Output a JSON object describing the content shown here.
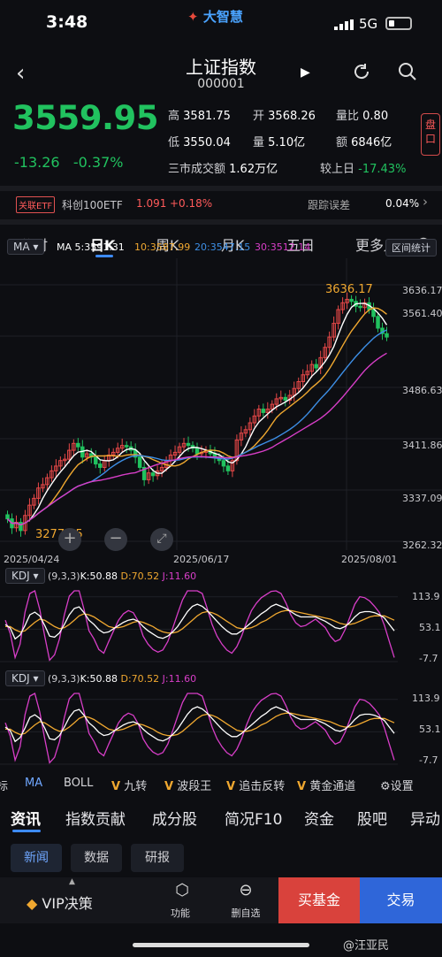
{
  "status": {
    "time": "3:48",
    "brand": "大智慧",
    "network": "5G"
  },
  "header": {
    "title": "上证指数",
    "code": "000001"
  },
  "quote": {
    "price": "3559.95",
    "change": "-13.26",
    "pct": "-0.37%",
    "high_label": "高",
    "high": "3581.75",
    "open_label": "开",
    "open": "3568.26",
    "vr_label": "量比",
    "vr": "0.80",
    "low_label": "低",
    "low": "3550.04",
    "vol_label": "量",
    "vol": "5.10亿",
    "amt_label": "额",
    "amt": "6846亿",
    "market_turnover_label": "三市成交额",
    "market_turnover": "1.62万亿",
    "vs_prev_label": "较上日",
    "vs_prev": "-17.43%",
    "panel_btn": "盘口"
  },
  "etf": {
    "tag": "关联ETF",
    "name": "科创100ETF",
    "price": "1.091",
    "pct": "+0.18%",
    "track_label": "跟踪误差",
    "track": "0.04%"
  },
  "tabs": [
    "分时",
    "日K",
    "周K",
    "月K",
    "五日",
    "更多"
  ],
  "ma": {
    "chip": "MA",
    "ma5": "MA 5:3591.31",
    "ma10": "10:3587.99",
    "ma20": "20:3547.15",
    "ma30": "30:3512.14",
    "range_btn": "区间统计",
    "colors": {
      "ma5": "#ffffff",
      "ma10": "#f0a830",
      "ma20": "#3d8fe6",
      "ma30": "#d83ec8"
    }
  },
  "kline": {
    "y_ticks": [
      "3636.17",
      "3561.40",
      "3486.63",
      "3411.86",
      "3337.09",
      "3262.32"
    ],
    "dates": [
      "2025/04/24",
      "2025/06/17",
      "2025/08/01"
    ],
    "max_label": "3636.17",
    "min_label": "3277.55"
  },
  "kdj1": {
    "name": "KDJ",
    "params": "(9,3,3)",
    "k": "K:50.88",
    "d": "D:70.52",
    "j": "J:11.60",
    "y_ticks": [
      "113.9",
      "53.1",
      "-7.7"
    ]
  },
  "kdj2": {
    "name": "KDJ",
    "params": "(9,3,3)",
    "k": "K:50.88",
    "d": "D:70.52",
    "j": "J:11.60",
    "y_ticks": [
      "113.9",
      "53.1",
      "-7.7"
    ]
  },
  "indicators": [
    "标",
    "MA",
    "BOLL",
    "九转",
    "波段王",
    "追击反转",
    "黄金通道",
    "设置"
  ],
  "info_tabs": [
    "资讯",
    "指数贡献",
    "成分股",
    "简况F10",
    "资金",
    "股吧",
    "异动"
  ],
  "sub_tabs": [
    "新闻",
    "数据",
    "研报"
  ],
  "bottom": {
    "vip": "VIP决策",
    "func": "功能",
    "delete": "删自选",
    "buy": "买基金",
    "trade": "交易"
  },
  "watermark": "@汪亚民",
  "chart_data": {
    "type": "candlestick",
    "title": "",
    "y_range": [
      3262.32,
      3636.17
    ],
    "x_labels": [
      "2025/04/24",
      "2025/06/17",
      "2025/08/01"
    ],
    "ma": {
      "MA5": 3591.31,
      "MA10": 3587.99,
      "MA20": 3547.15,
      "MA30": 3512.14
    },
    "high_marker": 3636.17,
    "low_marker": 3277.55,
    "closes": [
      3295,
      3282,
      3290,
      3278,
      3300,
      3315,
      3325,
      3340,
      3345,
      3355,
      3365,
      3372,
      3380,
      3382,
      3395,
      3405,
      3400,
      3385,
      3390,
      3385,
      3375,
      3370,
      3380,
      3388,
      3392,
      3398,
      3402,
      3400,
      3395,
      3385,
      3370,
      3352,
      3362,
      3358,
      3365,
      3370,
      3380,
      3388,
      3392,
      3400,
      3405,
      3402,
      3398,
      3390,
      3392,
      3395,
      3390,
      3385,
      3380,
      3372,
      3365,
      3380,
      3410,
      3420,
      3425,
      3435,
      3445,
      3455,
      3450,
      3455,
      3462,
      3470,
      3472,
      3468,
      3475,
      3485,
      3495,
      3505,
      3510,
      3520,
      3515,
      3530,
      3545,
      3560,
      3580,
      3600,
      3610,
      3615,
      3612,
      3605,
      3603,
      3610,
      3600,
      3590,
      3573,
      3565,
      3560
    ]
  },
  "kdj_data": {
    "k": [
      62,
      55,
      35,
      42,
      60,
      80,
      85,
      78,
      60,
      40,
      38,
      46,
      62,
      80,
      92,
      95,
      84,
      70,
      62,
      52,
      46,
      48,
      54,
      60,
      66,
      70,
      72,
      68,
      58,
      50,
      44,
      38,
      36,
      40,
      48,
      58,
      72,
      86,
      96,
      100,
      96,
      88,
      78,
      68,
      58,
      50,
      44,
      44,
      50,
      58,
      66,
      74,
      82,
      88,
      96,
      100,
      96,
      92,
      86,
      80,
      76,
      76,
      76,
      76,
      72,
      68,
      62,
      56,
      54,
      58,
      66,
      76,
      84,
      86,
      86,
      84,
      80,
      74,
      62,
      50
    ],
    "d": [
      58,
      58,
      52,
      48,
      50,
      58,
      66,
      72,
      70,
      64,
      58,
      54,
      56,
      62,
      70,
      78,
      82,
      80,
      76,
      70,
      64,
      58,
      56,
      56,
      58,
      62,
      66,
      68,
      66,
      62,
      58,
      52,
      48,
      46,
      46,
      48,
      54,
      62,
      70,
      78,
      84,
      86,
      84,
      80,
      74,
      68,
      62,
      56,
      54,
      54,
      56,
      60,
      66,
      70,
      76,
      82,
      86,
      88,
      88,
      86,
      84,
      82,
      80,
      78,
      76,
      74,
      72,
      68,
      64,
      62,
      62,
      64,
      68,
      72,
      76,
      78,
      78,
      78,
      74,
      70
    ],
    "j": [
      70,
      45,
      0,
      25,
      85,
      120,
      125,
      90,
      40,
      -5,
      5,
      35,
      80,
      115,
      125,
      125,
      90,
      50,
      35,
      15,
      8,
      30,
      50,
      70,
      82,
      88,
      84,
      68,
      40,
      25,
      15,
      10,
      14,
      30,
      55,
      82,
      108,
      125,
      125,
      125,
      120,
      92,
      62,
      40,
      25,
      14,
      8,
      20,
      40,
      66,
      88,
      102,
      112,
      118,
      124,
      125,
      120,
      102,
      80,
      65,
      58,
      60,
      66,
      72,
      64,
      56,
      40,
      30,
      34,
      52,
      76,
      100,
      114,
      112,
      106,
      96,
      84,
      60,
      30,
      0
    ]
  }
}
